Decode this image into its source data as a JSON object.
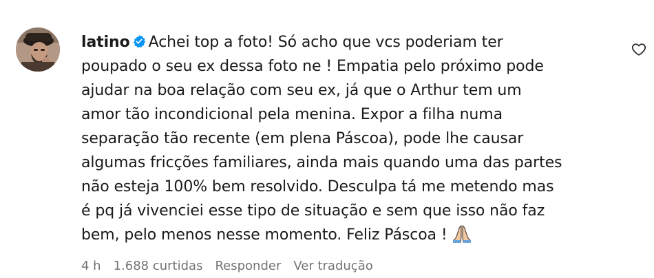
{
  "comment": {
    "username": "latino",
    "verified": true,
    "lines": [
      "Achei top a foto! Só acho que vcs poderiam ter",
      "poupado o seu ex dessa foto ne ! Empatia pelo próximo pode",
      "ajudar na boa relação com seu ex, já que o Arthur tem um",
      "amor tão incondicional pela menina. Expor a filha numa",
      "separação tão recente (em plena Páscoa), pode lhe causar",
      "algumas fricções familiares, ainda mais quando uma das partes",
      "não esteja 100% bem resolvido. Desculpa tá me metendo mas",
      "é pq já vivenciei esse tipo de situação e sem que isso não faz",
      "bem, pelo menos nesse momento. Feliz Páscoa !"
    ],
    "end_emoji": "praying-hands-emoji",
    "meta": {
      "time": "4 h",
      "likes": "1.688 curtidas",
      "reply_label": "Responder",
      "translate_label": "Ver tradução"
    },
    "icons": {
      "like": "heart-outline-icon",
      "verified": "verified-badge-icon"
    },
    "colors": {
      "text": "#1a1a1a",
      "meta": "#737373",
      "verified": "#0095f6"
    }
  }
}
